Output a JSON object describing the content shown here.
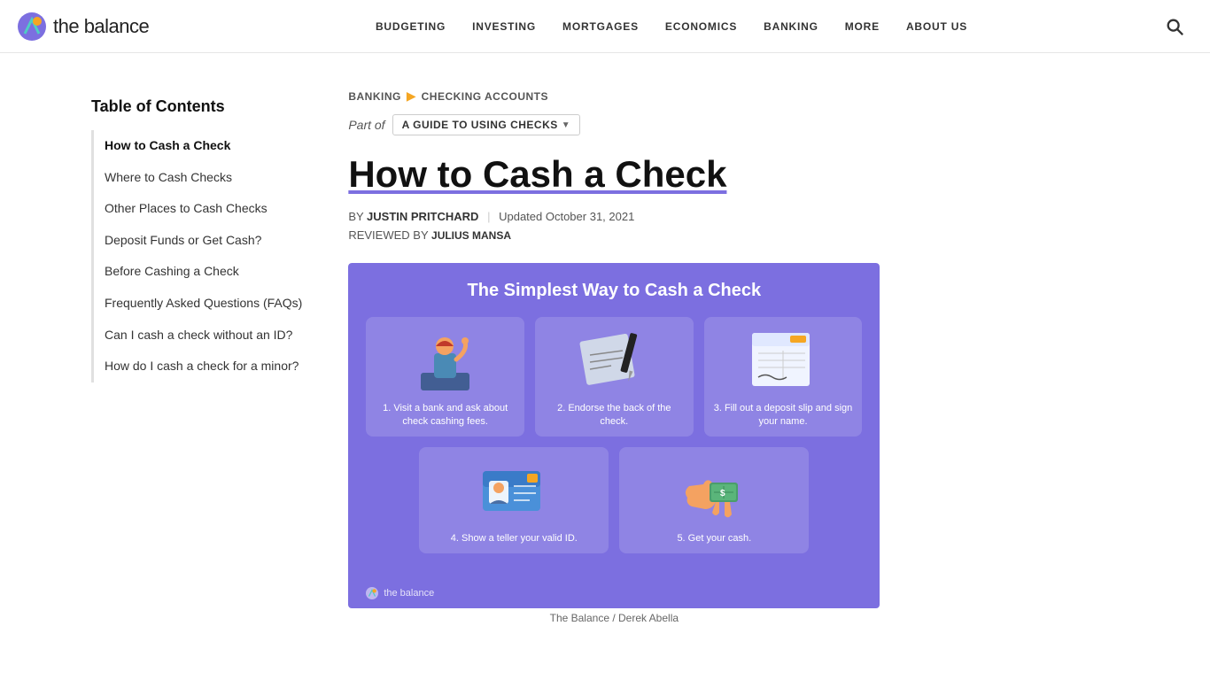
{
  "header": {
    "logo_text": "the balance",
    "nav_items": [
      {
        "label": "BUDGETING",
        "href": "#"
      },
      {
        "label": "INVESTING",
        "href": "#"
      },
      {
        "label": "MORTGAGES",
        "href": "#"
      },
      {
        "label": "ECONOMICS",
        "href": "#"
      },
      {
        "label": "BANKING",
        "href": "#"
      },
      {
        "label": "MORE",
        "href": "#"
      },
      {
        "label": "ABOUT US",
        "href": "#"
      }
    ]
  },
  "breadcrumb": {
    "parent": "BANKING",
    "current": "CHECKING ACCOUNTS"
  },
  "series": {
    "label": "Part of",
    "badge": "A GUIDE TO USING CHECKS"
  },
  "article": {
    "title": "How to Cash a Check",
    "author": "JUSTIN PRITCHARD",
    "updated": "Updated October 31, 2021",
    "reviewed_by_label": "REVIEWED BY",
    "reviewer": "JULIUS MANSA"
  },
  "hero": {
    "title": "The Simplest Way to Cash a Check",
    "steps": [
      {
        "text": "1. Visit a bank and ask about check cashing fees."
      },
      {
        "text": "2. Endorse the back of the check."
      },
      {
        "text": "3. Fill out a deposit slip and sign your name."
      },
      {
        "text": "4. Show a teller your valid ID."
      },
      {
        "text": "5. Get your cash."
      }
    ],
    "caption": "The Balance / Derek Abella",
    "logo_text": "the balance"
  },
  "toc": {
    "title": "Table of Contents",
    "items": [
      {
        "label": "How to Cash a Check",
        "active": true
      },
      {
        "label": "Where to Cash Checks"
      },
      {
        "label": "Other Places to Cash Checks"
      },
      {
        "label": "Deposit Funds or Get Cash?"
      },
      {
        "label": "Before Cashing a Check"
      },
      {
        "label": "Frequently Asked Questions (FAQs)"
      },
      {
        "label": "Can I cash a check without an ID?"
      },
      {
        "label": "How do I cash a check for a minor?"
      }
    ]
  }
}
